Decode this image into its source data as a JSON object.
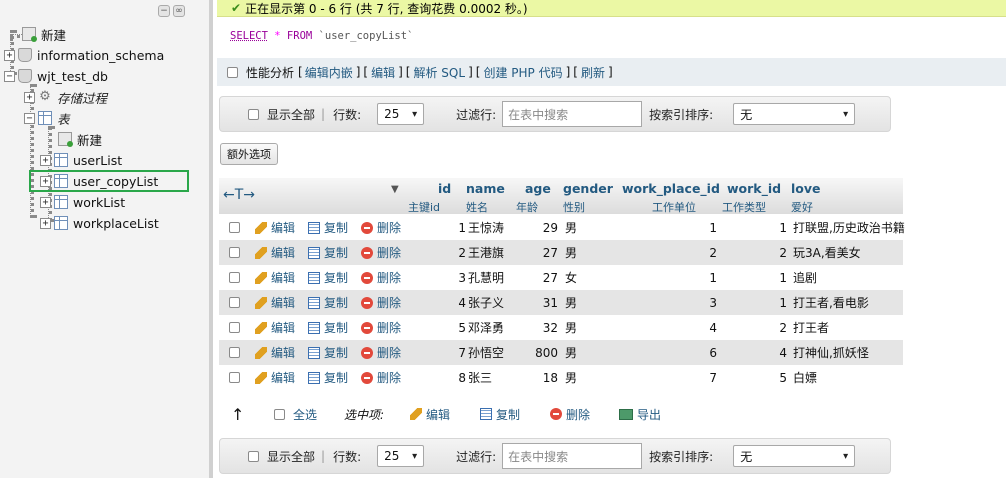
{
  "sidebar": {
    "tree": [
      {
        "label": "新建",
        "italic": false
      },
      {
        "label": "information_schema",
        "italic": false
      },
      {
        "label": "wjt_test_db",
        "italic": false
      },
      {
        "label": "存储过程",
        "italic": true
      },
      {
        "label": "表",
        "italic": true
      },
      {
        "label": "新建",
        "italic": false
      },
      {
        "label": "userList",
        "italic": false
      },
      {
        "label": "user_copyList",
        "italic": false
      },
      {
        "label": "workList",
        "italic": false
      },
      {
        "label": "workplaceList",
        "italic": false
      }
    ],
    "expanders": {
      "collapsed": "+",
      "expanded": "−"
    },
    "top_icons": [
      "−",
      "∞"
    ]
  },
  "success": {
    "check": "✔",
    "text": "正在显示第 0 - 6 行 (共 7 行, 查询花费 0.0002 秒。)"
  },
  "sql": {
    "select": "SELECT",
    "star": "*",
    "from": "FROM",
    "table": "`user_copyList`"
  },
  "sql_actions": {
    "profiling": "性能分析",
    "links": [
      "编辑内嵌",
      "编辑",
      "解析 SQL",
      "创建 PHP 代码",
      "刷新"
    ],
    "bracket_open": "[",
    "bracket_close": "]"
  },
  "nav": {
    "show_all": "显示全部",
    "separator": "|",
    "rows_label": "行数:",
    "rows_value": "25",
    "filter_label": "过滤行:",
    "filter_placeholder": "在表中搜索",
    "sort_label": "按索引排序:",
    "sort_value": "无"
  },
  "extra_options": "额外选项",
  "table": {
    "arrows": "←T→",
    "sort_indicator": "▼",
    "columns": [
      {
        "name": "id",
        "comment": "主键id"
      },
      {
        "name": "name",
        "comment": "姓名"
      },
      {
        "name": "age",
        "comment": "年龄"
      },
      {
        "name": "gender",
        "comment": "性别"
      },
      {
        "name": "work_place_id",
        "comment": "工作单位"
      },
      {
        "name": "work_id",
        "comment": "工作类型"
      },
      {
        "name": "love",
        "comment": "爱好"
      }
    ],
    "actions": {
      "edit": "编辑",
      "copy": "复制",
      "delete": "删除"
    },
    "rows": [
      {
        "id": "1",
        "name": "王惊涛",
        "age": "29",
        "gender": "男",
        "work_place_id": "1",
        "work_id": "1",
        "love": "打联盟,历史政治书籍"
      },
      {
        "id": "2",
        "name": "王港旗",
        "age": "27",
        "gender": "男",
        "work_place_id": "2",
        "work_id": "2",
        "love": "玩3A,看美女"
      },
      {
        "id": "3",
        "name": "孔慧明",
        "age": "27",
        "gender": "女",
        "work_place_id": "1",
        "work_id": "1",
        "love": "追剧"
      },
      {
        "id": "4",
        "name": "张子义",
        "age": "31",
        "gender": "男",
        "work_place_id": "3",
        "work_id": "1",
        "love": "打王者,看电影"
      },
      {
        "id": "5",
        "name": "邓泽勇",
        "age": "32",
        "gender": "男",
        "work_place_id": "4",
        "work_id": "2",
        "love": "打王者"
      },
      {
        "id": "7",
        "name": "孙悟空",
        "age": "800",
        "gender": "男",
        "work_place_id": "6",
        "work_id": "4",
        "love": "打神仙,抓妖怪"
      },
      {
        "id": "8",
        "name": "张三",
        "age": "18",
        "gender": "男",
        "work_place_id": "7",
        "work_id": "5",
        "love": "白嫖"
      }
    ]
  },
  "bulk": {
    "up_arrow": "↑",
    "select_all": "全选",
    "with_selected": "选中项:",
    "edit": "编辑",
    "copy": "复制",
    "delete": "删除",
    "export": "导出"
  },
  "colors": {
    "link": "#235a81",
    "success_bg": "#ebf8a4",
    "selected_border": "#2aa74a",
    "row_alt": "#e5e5e5"
  }
}
